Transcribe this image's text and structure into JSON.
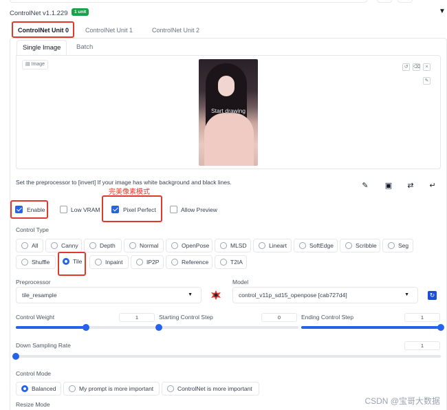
{
  "header": {
    "title": "ControlNet v1.1.229",
    "badge": "1 unit"
  },
  "unit_tabs": [
    "ControlNet Unit 0",
    "ControlNet Unit 1",
    "ControlNet Unit 2"
  ],
  "input_tabs": [
    "Single Image",
    "Batch"
  ],
  "image_area": {
    "label": "Image",
    "overlay_text": "Start drawing"
  },
  "hint": "Set the preprocessor to [invert] If your image has white background and black lines.",
  "annotation_note": "完美像素模式",
  "options": {
    "enable": {
      "label": "Enable",
      "checked": true
    },
    "low_vram": {
      "label": "Low VRAM",
      "checked": false
    },
    "pixel_perfect": {
      "label": "Pixel Perfect",
      "checked": true
    },
    "allow_preview": {
      "label": "Allow Preview",
      "checked": false
    }
  },
  "control_type": {
    "label": "Control Type",
    "items": [
      "All",
      "Canny",
      "Depth",
      "Normal",
      "OpenPose",
      "MLSD",
      "Lineart",
      "SoftEdge",
      "Scribble",
      "Seg",
      "Shuffle",
      "Tile",
      "Inpaint",
      "IP2P",
      "Reference",
      "T2IA"
    ],
    "selected": "Tile"
  },
  "preprocessor": {
    "label": "Preprocessor",
    "value": "tile_resample"
  },
  "model": {
    "label": "Model",
    "value": "control_v11p_sd15_openpose [cab727d4]"
  },
  "sliders": {
    "control_weight": {
      "label": "Control Weight",
      "value": "1",
      "fraction": 0.5
    },
    "start_step": {
      "label": "Starting Control Step",
      "value": "0",
      "fraction": 0.0
    },
    "end_step": {
      "label": "Ending Control Step",
      "value": "1",
      "fraction": 1.0
    },
    "down_sampling": {
      "label": "Down Sampling Rate",
      "value": "1",
      "fraction": 0.0
    }
  },
  "control_mode": {
    "label": "Control Mode",
    "items": [
      "Balanced",
      "My prompt is more important",
      "ControlNet is more important"
    ],
    "selected": "Balanced"
  },
  "resize_mode": {
    "label": "Resize Mode"
  },
  "watermark": "CSDN @宝哥大数据",
  "colors": {
    "accent": "#2563eb",
    "annotation_red": "#e0392b",
    "badge_green": "#16a34a"
  }
}
